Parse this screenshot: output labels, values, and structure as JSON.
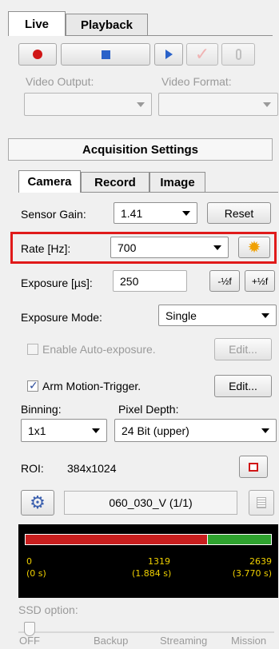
{
  "tabs": {
    "live": "Live",
    "playback": "Playback"
  },
  "labels": {
    "video_output": "Video Output:",
    "video_format": "Video Format:"
  },
  "acquisition": {
    "header": "Acquisition Settings",
    "subtabs": {
      "camera": "Camera",
      "record": "Record",
      "image": "Image"
    }
  },
  "camera": {
    "sensor_gain_label": "Sensor Gain:",
    "sensor_gain_value": "1.41",
    "reset_label": "Reset",
    "rate_label": "Rate [Hz]:",
    "rate_value": "700",
    "exposure_label": "Exposure [µs]:",
    "exposure_value": "250",
    "half_f_label": "-½f",
    "plus_half_f_label": "+½f",
    "exposure_mode_label": "Exposure Mode:",
    "exposure_mode_value": "Single",
    "auto_exposure_label": "Enable Auto-exposure.",
    "edit_label": "Edit...",
    "arm_trigger_label": "Arm Motion-Trigger.",
    "binning_label": "Binning:",
    "binning_value": "1x1",
    "pixel_depth_label": "Pixel Depth:",
    "pixel_depth_value": "24 Bit (upper)",
    "roi_label": "ROI:",
    "roi_value": "384x1024",
    "file_name": "060_030_V (1/1)"
  },
  "buffer": {
    "start_frame": "0",
    "start_time": "(0 s)",
    "mid_frame": "1319",
    "mid_time": "(1.884 s)",
    "end_frame": "2639",
    "end_time": "(3.770 s)",
    "fill_fraction": 0.74
  },
  "ssd": {
    "label": "SSD option:",
    "ticks": [
      "OFF",
      "Backup",
      "Streaming",
      "Mission"
    ]
  },
  "colors": {
    "highlight": "#e01a1a",
    "record": "#d01616",
    "bar_red": "#c81e1e",
    "bar_green": "#2fa32f",
    "bar_text": "#f0d000"
  }
}
